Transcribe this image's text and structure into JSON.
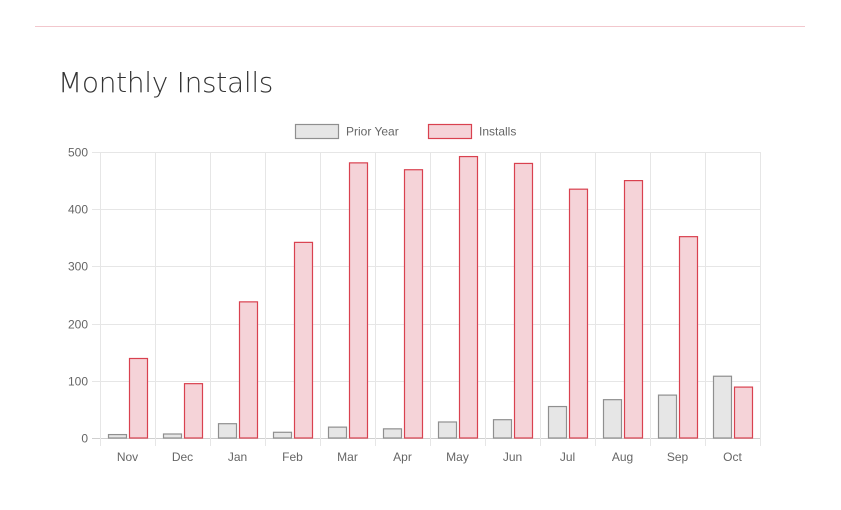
{
  "page": {
    "title": "Monthly Installs"
  },
  "colors": {
    "prior_fill": "#e6e6e6",
    "prior_stroke": "#8f8f8f",
    "installs_fill": "#f5d3d8",
    "installs_stroke": "#d9414f",
    "grid": "#e6e6e6",
    "rule": "#f2c7cd"
  },
  "chart_data": {
    "type": "bar",
    "categories": [
      "Nov",
      "Dec",
      "Jan",
      "Feb",
      "Mar",
      "Apr",
      "May",
      "Jun",
      "Jul",
      "Aug",
      "Sep",
      "Oct"
    ],
    "series": [
      {
        "name": "Prior Year",
        "values": [
          6,
          7,
          25,
          10,
          19,
          16,
          28,
          32,
          55,
          67,
          75,
          108
        ]
      },
      {
        "name": "Installs",
        "values": [
          139,
          95,
          238,
          342,
          481,
          469,
          492,
          480,
          435,
          450,
          352,
          89
        ]
      }
    ],
    "ylim": [
      0,
      500
    ],
    "yticks": [
      0,
      100,
      200,
      300,
      400,
      500
    ],
    "grid": true,
    "legend_position": "top",
    "xlabel": "",
    "ylabel": ""
  }
}
